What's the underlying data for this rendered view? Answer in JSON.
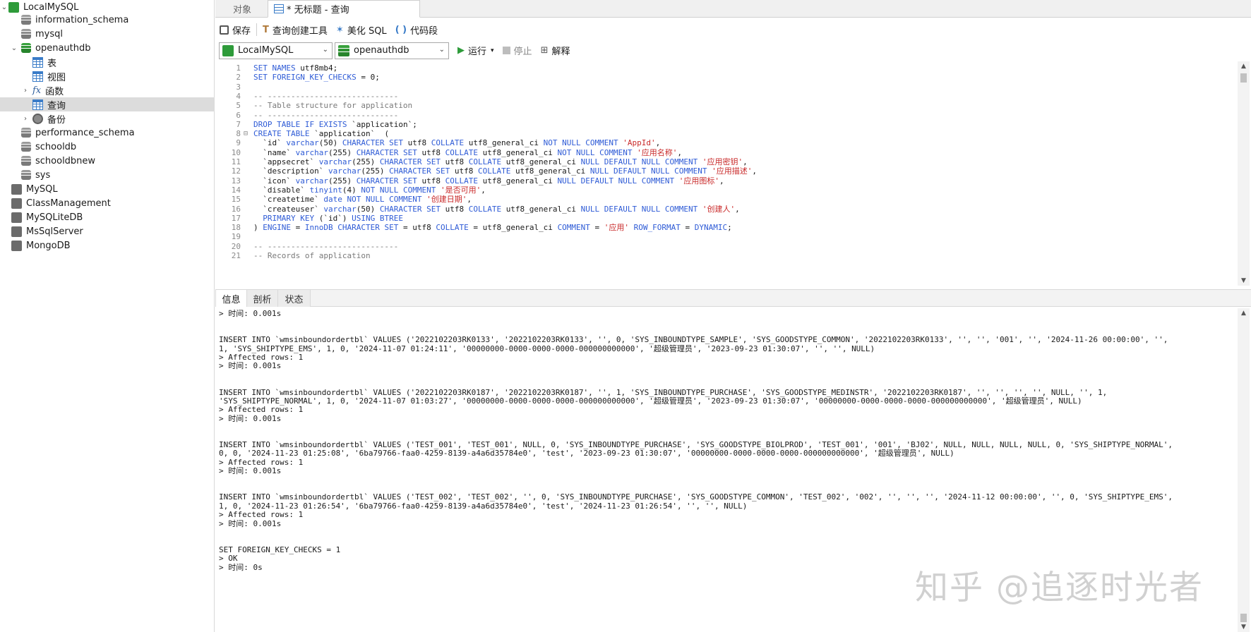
{
  "navigator": {
    "items": [
      {
        "label": "LocalMySQL",
        "icon": "mysql-connection-icon"
      },
      {
        "label": "information_schema",
        "icon": "database-icon"
      },
      {
        "label": "mysql",
        "icon": "database-icon"
      },
      {
        "label": "openauthdb",
        "icon": "database-icon"
      },
      {
        "label": "表",
        "icon": "table-icon"
      },
      {
        "label": "视图",
        "icon": "view-icon"
      },
      {
        "label": "函数",
        "icon": "function-icon"
      },
      {
        "label": "查询",
        "icon": "query-icon"
      },
      {
        "label": "备份",
        "icon": "backup-icon"
      },
      {
        "label": "performance_schema",
        "icon": "database-icon"
      },
      {
        "label": "schooldb",
        "icon": "database-icon"
      },
      {
        "label": "schooldbnew",
        "icon": "database-icon"
      },
      {
        "label": "sys",
        "icon": "database-icon"
      },
      {
        "label": "MySQL",
        "icon": "mysql-connection-icon"
      },
      {
        "label": "ClassManagement",
        "icon": "sqlite-connection-icon"
      },
      {
        "label": "MySQLiteDB",
        "icon": "sqlite-connection-icon"
      },
      {
        "label": "MsSqlServer",
        "icon": "sqlserver-connection-icon"
      },
      {
        "label": "MongoDB",
        "icon": "mongodb-connection-icon"
      }
    ]
  },
  "tabs": {
    "objects": "对象",
    "query": "* 无标题 - 查询"
  },
  "toolbar": {
    "save": "保存",
    "query_builder": "查询创建工具",
    "beautify": "美化 SQL",
    "snippet": "代码段",
    "connection": "LocalMySQL",
    "database": "openauthdb",
    "run": "运行",
    "stop": "停止",
    "explain": "解释"
  },
  "editor": {
    "lines": [
      "SET NAMES utf8mb4;",
      "SET FOREIGN_KEY_CHECKS = 0;",
      "",
      "-- ----------------------------",
      "-- Table structure for application",
      "-- ----------------------------",
      "DROP TABLE IF EXISTS `application`;",
      "CREATE TABLE `application`  (",
      "  `id` varchar(50) CHARACTER SET utf8 COLLATE utf8_general_ci NOT NULL COMMENT 'AppId',",
      "  `name` varchar(255) CHARACTER SET utf8 COLLATE utf8_general_ci NOT NULL COMMENT '应用名称',",
      "  `appsecret` varchar(255) CHARACTER SET utf8 COLLATE utf8_general_ci NULL DEFAULT NULL COMMENT '应用密钥',",
      "  `description` varchar(255) CHARACTER SET utf8 COLLATE utf8_general_ci NULL DEFAULT NULL COMMENT '应用描述',",
      "  `icon` varchar(255) CHARACTER SET utf8 COLLATE utf8_general_ci NULL DEFAULT NULL COMMENT '应用图标',",
      "  `disable` tinyint(4) NOT NULL COMMENT '是否可用',",
      "  `createtime` date NOT NULL COMMENT '创建日期',",
      "  `createuser` varchar(50) CHARACTER SET utf8 COLLATE utf8_general_ci NULL DEFAULT NULL COMMENT '创建人',",
      "  PRIMARY KEY (`id`) USING BTREE",
      ") ENGINE = InnoDB CHARACTER SET = utf8 COLLATE = utf8_general_ci COMMENT = '应用' ROW_FORMAT = DYNAMIC;",
      "",
      "-- ----------------------------",
      "-- Records of application"
    ]
  },
  "result_tabs": {
    "info": "信息",
    "profile": "剖析",
    "status": "状态"
  },
  "messages": {
    "lines": [
      "> 时间: 0.001s",
      "",
      "",
      "INSERT INTO `wmsinboundordertbl` VALUES ('2022102203RK0133', '2022102203RK0133', '', 0, 'SYS_INBOUNDTYPE_SAMPLE', 'SYS_GOODSTYPE_COMMON', '2022102203RK0133', '', '', '001', '', '2024-11-26 00:00:00', '',",
      "1, 'SYS_SHIPTYPE_EMS', 1, 0, '2024-11-07 01:24:11', '00000000-0000-0000-0000-000000000000', '超级管理员', '2023-09-23 01:30:07', '', '', NULL)",
      "> Affected rows: 1",
      "> 时间: 0.001s",
      "",
      "",
      "INSERT INTO `wmsinboundordertbl` VALUES ('2022102203RK0187', '2022102203RK0187', '', 1, 'SYS_INBOUNDTYPE_PURCHASE', 'SYS_GOODSTYPE_MEDINSTR', '2022102203RK0187', '', '', '', '', NULL, '', 1,",
      "'SYS_SHIPTYPE_NORMAL', 1, 0, '2024-11-07 01:03:27', '00000000-0000-0000-0000-000000000000', '超级管理员', '2023-09-23 01:30:07', '00000000-0000-0000-0000-000000000000', '超级管理员', NULL)",
      "> Affected rows: 1",
      "> 时间: 0.001s",
      "",
      "",
      "INSERT INTO `wmsinboundordertbl` VALUES ('TEST_001', 'TEST_001', NULL, 0, 'SYS_INBOUNDTYPE_PURCHASE', 'SYS_GOODSTYPE_BIOLPROD', 'TEST_001', '001', 'BJ02', NULL, NULL, NULL, NULL, 0, 'SYS_SHIPTYPE_NORMAL',",
      "0, 0, '2024-11-23 01:25:08', '6ba79766-faa0-4259-8139-a4a6d35784e0', 'test', '2023-09-23 01:30:07', '00000000-0000-0000-0000-000000000000', '超级管理员', NULL)",
      "> Affected rows: 1",
      "> 时间: 0.001s",
      "",
      "",
      "INSERT INTO `wmsinboundordertbl` VALUES ('TEST_002', 'TEST_002', '', 0, 'SYS_INBOUNDTYPE_PURCHASE', 'SYS_GOODSTYPE_COMMON', 'TEST_002', '002', '', '', '', '2024-11-12 00:00:00', '', 0, 'SYS_SHIPTYPE_EMS',",
      "1, 0, '2024-11-23 01:26:54', '6ba79766-faa0-4259-8139-a4a6d35784e0', 'test', '2024-11-23 01:26:54', '', '', NULL)",
      "> Affected rows: 1",
      "> 时间: 0.001s",
      "",
      "",
      "SET FOREIGN_KEY_CHECKS = 1",
      "> OK",
      "> 时间: 0s"
    ]
  },
  "watermark": "知乎 @追逐时光者",
  "colors": {
    "keyword": "#2e5bd6",
    "string": "#c92a2a",
    "comment": "#7a7a7a",
    "selected_row": "#dcdcdc",
    "connection_green": "#2e9b3a"
  }
}
